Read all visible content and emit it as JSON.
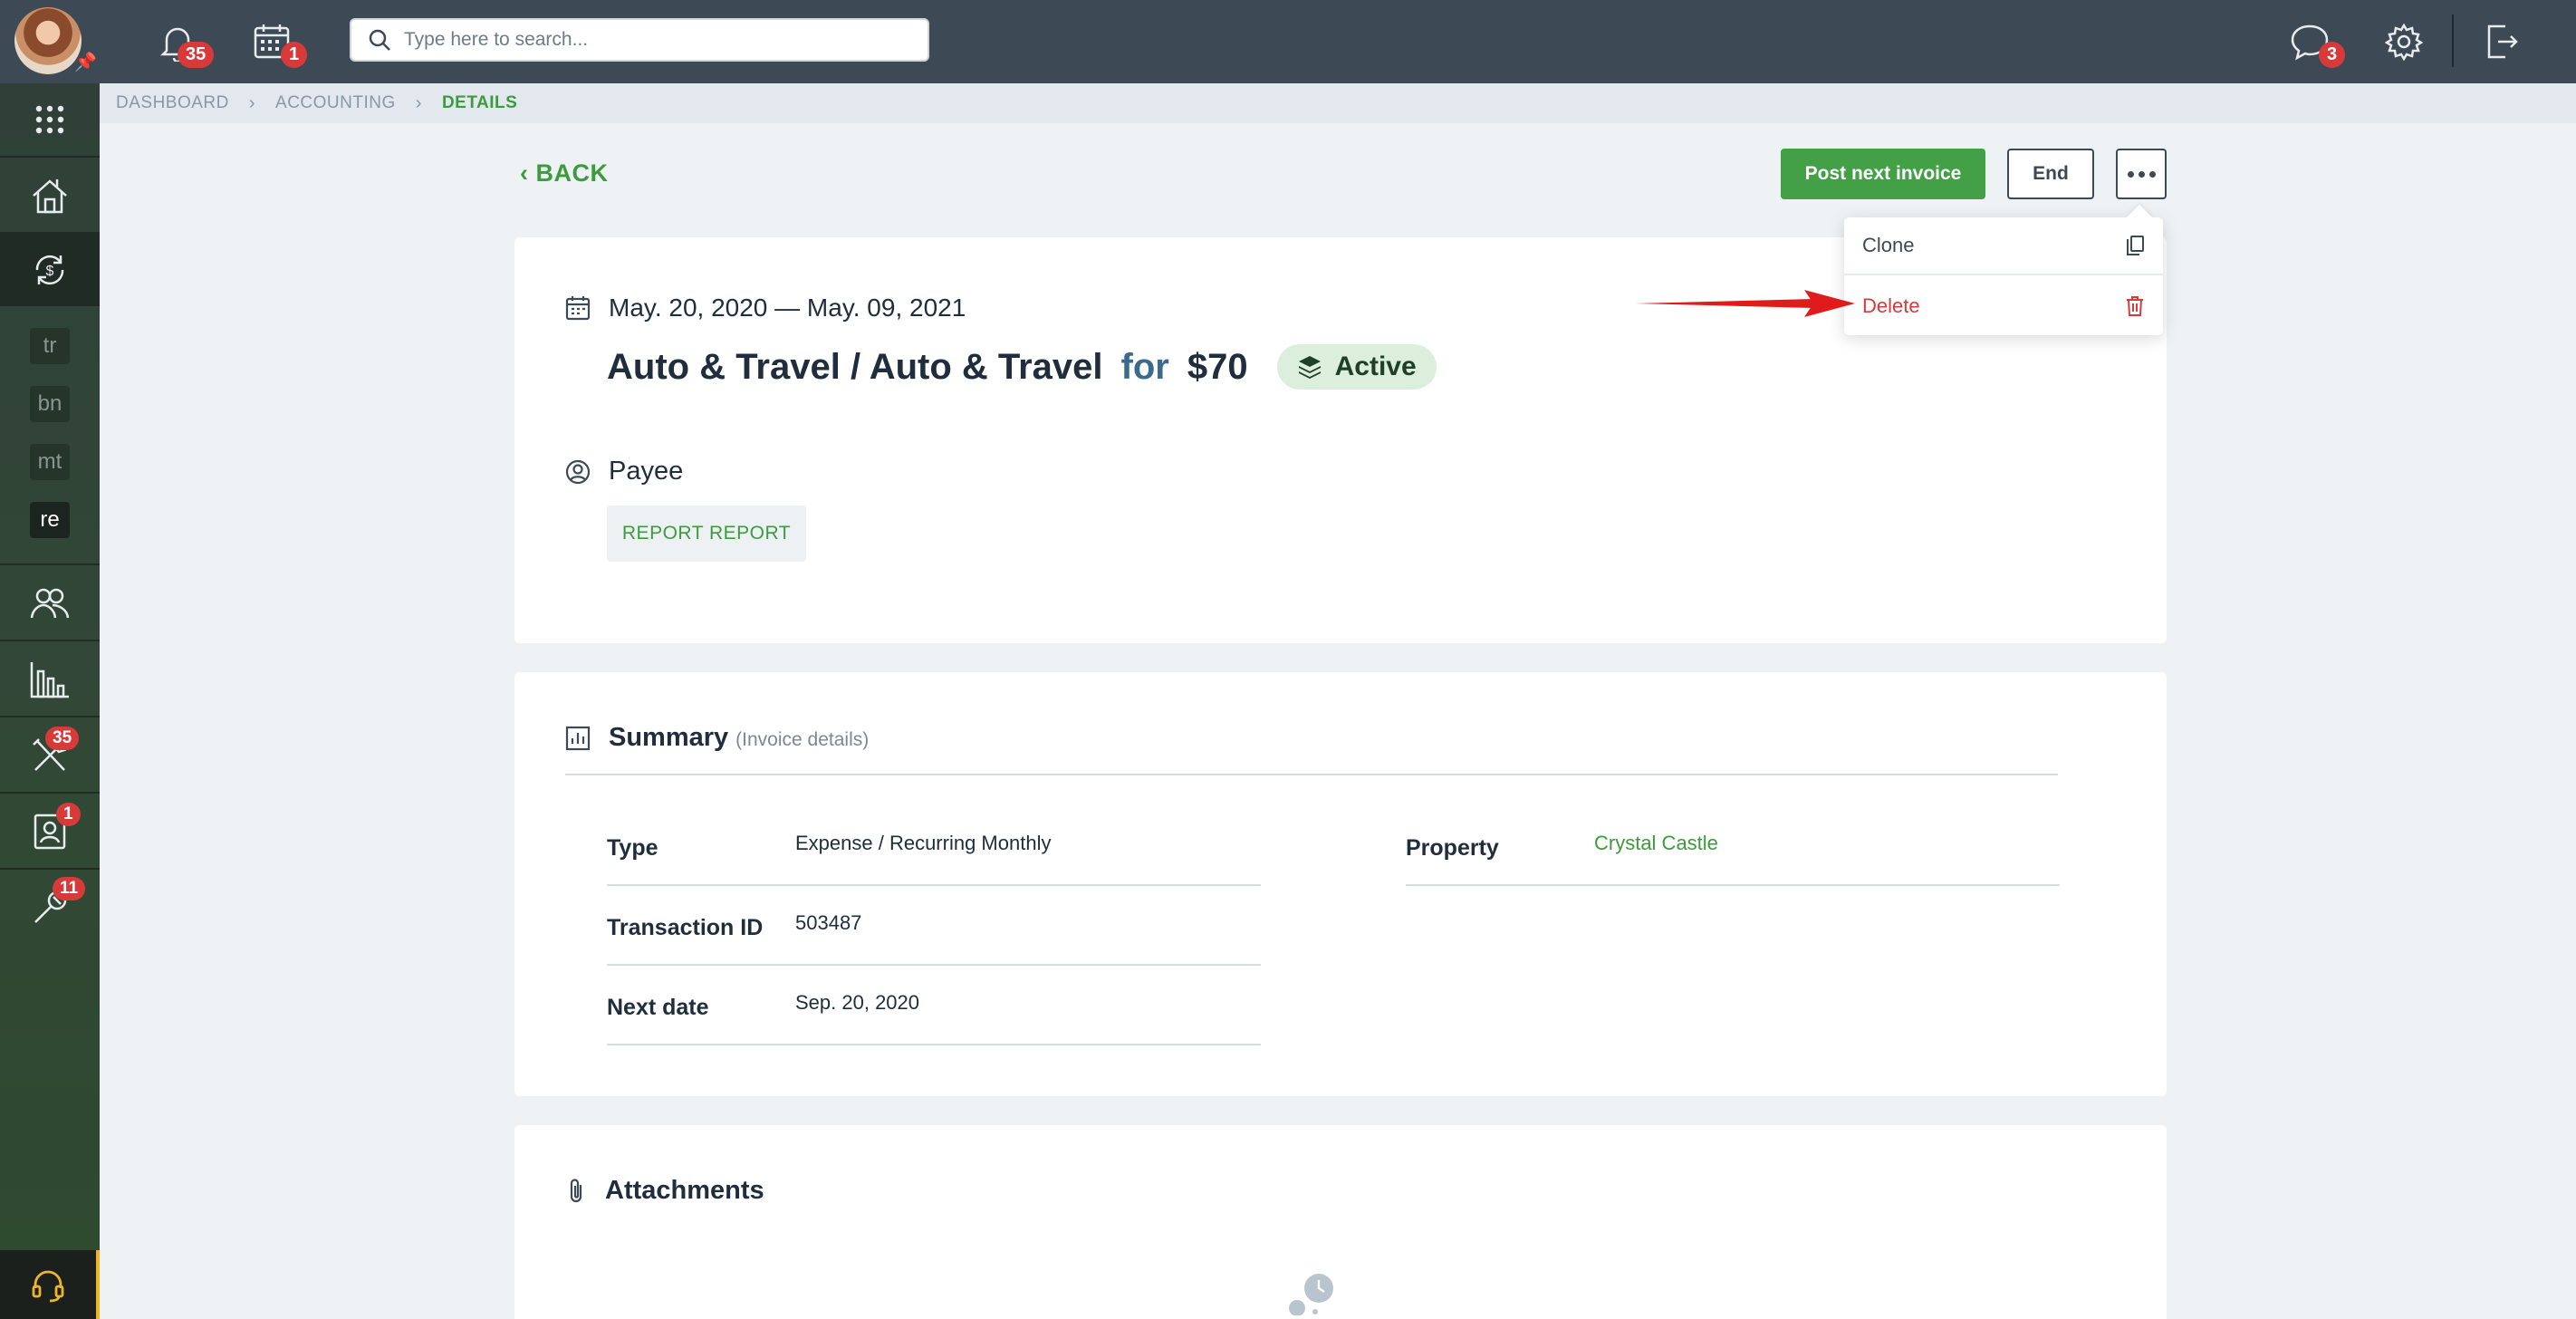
{
  "topbar": {
    "notifications_badge": "35",
    "calendar_badge": "1",
    "search_placeholder": "Type here to search...",
    "chat_badge": "3"
  },
  "sidebar": {
    "mini_items": [
      "tr",
      "bn",
      "mt",
      "re"
    ],
    "badges": {
      "tools": "35",
      "contacts": "1",
      "maintenance": "11"
    }
  },
  "breadcrumb": [
    "DASHBOARD",
    "ACCOUNTING",
    "DETAILS"
  ],
  "page": {
    "back_label": "BACK",
    "post_next_invoice_label": "Post next invoice",
    "end_label": "End"
  },
  "dropdown": {
    "clone_label": "Clone",
    "delete_label": "Delete"
  },
  "details": {
    "date_range": "May. 20, 2020 — May. 09, 2021",
    "title": "Auto & Travel / Auto & Travel",
    "for_label": "for",
    "amount": "$70",
    "status": "Active",
    "payee_label": "Payee",
    "payee_name": "REPORT REPORT"
  },
  "summary": {
    "title": "Summary",
    "subtitle": "(Invoice details)",
    "type_label": "Type",
    "type_value": "Expense / Recurring Monthly",
    "transaction_label": "Transaction ID",
    "transaction_value": "503487",
    "next_date_label": "Next date",
    "next_date_value": "Sep. 20, 2020",
    "property_label": "Property",
    "property_value": "Crystal Castle"
  },
  "attachments": {
    "title": "Attachments"
  },
  "colors": {
    "accent_green": "#43a047",
    "danger_red": "#d83a3a",
    "topbar": "#3d4a55"
  }
}
